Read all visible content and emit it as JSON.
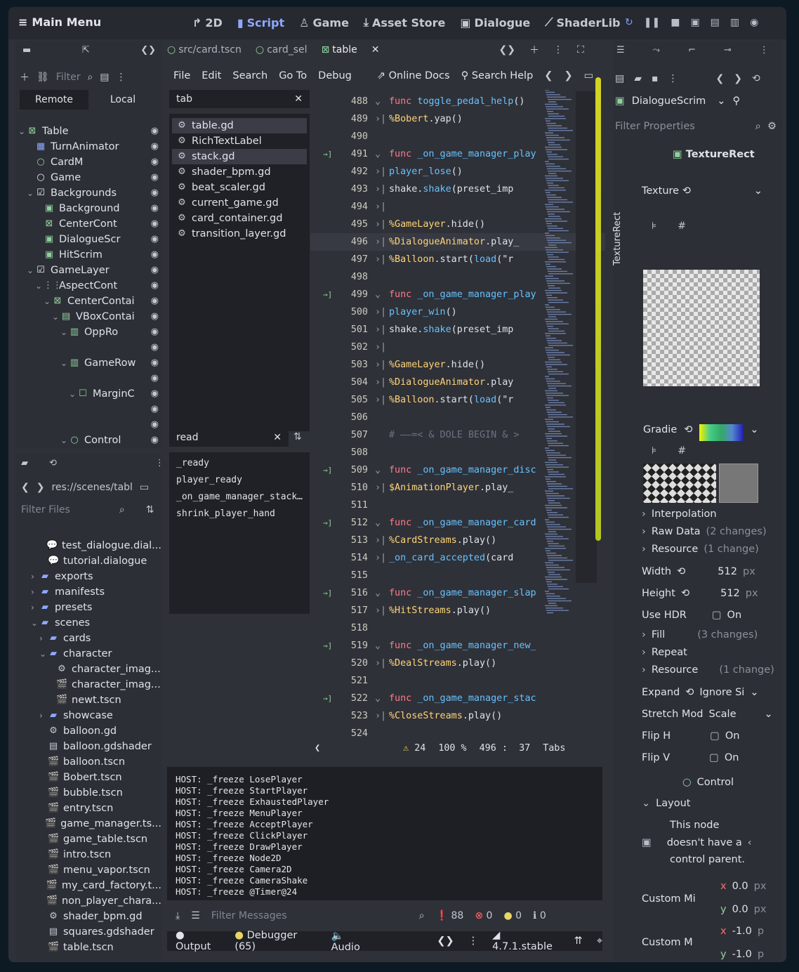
{
  "topbar": {
    "main_menu": "Main Menu",
    "ws_2d": "2D",
    "ws_script": "Script",
    "ws_game": "Game",
    "ws_asset": "Asset Store",
    "ws_dialogue": "Dialogue",
    "ws_shader": "ShaderLib"
  },
  "scene": {
    "remote": "Remote",
    "local": "Local",
    "filter": "Filter",
    "tree": [
      {
        "label": "Table",
        "indent": 0,
        "icon": "⊠",
        "color": "green",
        "arrow": "⌄"
      },
      {
        "label": "TurnAnimator",
        "indent": 1,
        "icon": "▦",
        "color": "blue"
      },
      {
        "label": "CardM",
        "indent": 1,
        "icon": "○",
        "color": "green"
      },
      {
        "label": "Game",
        "indent": 1,
        "icon": "○",
        "color": "white"
      },
      {
        "label": "Backgrounds",
        "indent": 1,
        "icon": "☑",
        "color": "white",
        "arrow": "⌄"
      },
      {
        "label": "Background",
        "indent": 2,
        "icon": "▣",
        "color": "green"
      },
      {
        "label": "CenterCont",
        "indent": 2,
        "icon": "⊠",
        "color": "green"
      },
      {
        "label": "DialogueScr",
        "indent": 2,
        "icon": "▣",
        "color": "green"
      },
      {
        "label": "HitScrim",
        "indent": 2,
        "icon": "▣",
        "color": "green"
      },
      {
        "label": "GameLayer",
        "indent": 1,
        "icon": "☑",
        "color": "white",
        "arrow": "⌄"
      },
      {
        "label": "AspectCont",
        "indent": 2,
        "icon": "⋮⋮",
        "color": "green",
        "arrow": "⌄"
      },
      {
        "label": "CenterContai",
        "indent": 3,
        "icon": "⊠",
        "color": "green",
        "arrow": "⌄"
      },
      {
        "label": "VBoxContai",
        "indent": 4,
        "icon": "▤",
        "color": "green",
        "arrow": "⌄"
      },
      {
        "label": "OppRo",
        "indent": 5,
        "icon": "▥",
        "color": "green",
        "arrow": "⌄"
      },
      {
        "label": "",
        "indent": 6,
        "icon": "",
        "color": "green"
      },
      {
        "label": "GameRow",
        "indent": 5,
        "icon": "▥",
        "color": "green",
        "arrow": "⌄"
      },
      {
        "label": "",
        "indent": 6,
        "icon": "",
        "color": "green"
      },
      {
        "label": "MarginC",
        "indent": 6,
        "icon": "☐",
        "color": "green",
        "arrow": "⌄"
      },
      {
        "label": "",
        "indent": 7,
        "icon": "",
        "color": "green"
      },
      {
        "label": "",
        "indent": 6,
        "icon": "",
        "color": "green"
      },
      {
        "label": "Control",
        "indent": 5,
        "icon": "○",
        "color": "green",
        "arrow": "⌄"
      }
    ]
  },
  "fs": {
    "path": "res://scenes/tabl",
    "filter": "Filter Files",
    "files": [
      {
        "label": "test_dialogue.dial...",
        "indent": 1,
        "icon": "💬"
      },
      {
        "label": "tutorial.dialogue",
        "indent": 1,
        "icon": "💬"
      },
      {
        "label": "exports",
        "indent": 0,
        "icon": "▰",
        "folder": true,
        "arrow": "›"
      },
      {
        "label": "manifests",
        "indent": 0,
        "icon": "▰",
        "folder": true,
        "arrow": "›"
      },
      {
        "label": "presets",
        "indent": 0,
        "icon": "▰",
        "folder": true,
        "arrow": "›"
      },
      {
        "label": "scenes",
        "indent": 0,
        "icon": "▰",
        "folder": true,
        "arrow": "⌄"
      },
      {
        "label": "cards",
        "indent": 1,
        "icon": "▰",
        "folder": true,
        "arrow": "›"
      },
      {
        "label": "character",
        "indent": 1,
        "icon": "▰",
        "folder": true,
        "arrow": "⌄"
      },
      {
        "label": "character_imag...",
        "indent": 2,
        "icon": "⚙"
      },
      {
        "label": "character_imag...",
        "indent": 2,
        "icon": "🎬"
      },
      {
        "label": "newt.tscn",
        "indent": 2,
        "icon": "🎬"
      },
      {
        "label": "showcase",
        "indent": 1,
        "icon": "▰",
        "folder": true,
        "arrow": "›"
      },
      {
        "label": "balloon.gd",
        "indent": 1,
        "icon": "⚙"
      },
      {
        "label": "balloon.gdshader",
        "indent": 1,
        "icon": "▤"
      },
      {
        "label": "balloon.tscn",
        "indent": 1,
        "icon": "🎬"
      },
      {
        "label": "Bobert.tscn",
        "indent": 1,
        "icon": "🎬"
      },
      {
        "label": "bubble.tscn",
        "indent": 1,
        "icon": "🎬"
      },
      {
        "label": "entry.tscn",
        "indent": 1,
        "icon": "🎬"
      },
      {
        "label": "game_manager.ts...",
        "indent": 1,
        "icon": "🎬"
      },
      {
        "label": "game_table.tscn",
        "indent": 1,
        "icon": "🎬"
      },
      {
        "label": "intro.tscn",
        "indent": 1,
        "icon": "🎬"
      },
      {
        "label": "menu_vapor.tscn",
        "indent": 1,
        "icon": "🎬"
      },
      {
        "label": "my_card_factory.t...",
        "indent": 1,
        "icon": "🎬"
      },
      {
        "label": "non_player_chara...",
        "indent": 1,
        "icon": "🎬"
      },
      {
        "label": "shader_bpm.gd",
        "indent": 1,
        "icon": "⚙"
      },
      {
        "label": "squares.gdshader",
        "indent": 1,
        "icon": "▤"
      },
      {
        "label": "table.tscn",
        "indent": 1,
        "icon": "🎬"
      }
    ]
  },
  "tabs": {
    "t1": "src/card.tscn",
    "t2": "card_sel",
    "t3": "table"
  },
  "menu": {
    "file": "File",
    "edit": "Edit",
    "search": "Search",
    "goto": "Go To",
    "debug": "Debug",
    "docs": "Online Docs",
    "help": "Search Help"
  },
  "scripts": {
    "filter": "tab",
    "items": [
      "table.gd",
      "RichTextLabel",
      "stack.gd",
      "shader_bpm.gd",
      "beat_scaler.gd",
      "current_game.gd",
      "card_container.gd",
      "transition_layer.gd"
    ]
  },
  "methods": {
    "filter": "read",
    "items": [
      "_ready",
      "player_ready",
      "_on_game_manager_stack…",
      "shrink_player_hand"
    ]
  },
  "code": [
    {
      "n": "488",
      "fold": "⌄",
      "t": [
        [
          "kw",
          "func "
        ],
        [
          "fn",
          "toggle_pedal_help"
        ],
        [
          "",
          "()"
        ]
      ]
    },
    {
      "n": "489",
      "fold": "›|",
      "t": [
        [
          "str",
          "%Bobert"
        ],
        [
          "",
          ".yap()"
        ]
      ]
    },
    {
      "n": "490",
      "fold": "",
      "t": []
    },
    {
      "n": "491",
      "fold": "⌄",
      "mark": "→]",
      "t": [
        [
          "kw",
          "func "
        ],
        [
          "fn",
          "_on_game_manager_play"
        ]
      ]
    },
    {
      "n": "492",
      "fold": "›|",
      "t": [
        [
          "fn",
          "player_lose"
        ],
        [
          "",
          "()"
        ]
      ]
    },
    {
      "n": "493",
      "fold": "›|",
      "t": [
        [
          "",
          "shake."
        ],
        [
          "fn",
          "shake"
        ],
        [
          "",
          "(preset_imp"
        ]
      ]
    },
    {
      "n": "494",
      "fold": "›|",
      "t": []
    },
    {
      "n": "495",
      "fold": "›|",
      "t": [
        [
          "str",
          "%GameLayer"
        ],
        [
          "",
          ".hide()"
        ]
      ]
    },
    {
      "n": "496",
      "fold": "›|",
      "t": [
        [
          "str",
          "%DialogueAnimator"
        ],
        [
          "",
          ".play_"
        ]
      ],
      "hl": true
    },
    {
      "n": "497",
      "fold": "›|",
      "t": [
        [
          "str",
          "%Balloon"
        ],
        [
          "",
          ".start("
        ],
        [
          "fn",
          "load"
        ],
        [
          "",
          "(\"r"
        ]
      ]
    },
    {
      "n": "498",
      "fold": "",
      "t": []
    },
    {
      "n": "499",
      "fold": "⌄",
      "mark": "→]",
      "t": [
        [
          "kw",
          "func "
        ],
        [
          "fn",
          "_on_game_manager_play"
        ]
      ]
    },
    {
      "n": "500",
      "fold": "›|",
      "t": [
        [
          "fn",
          "player_win"
        ],
        [
          "",
          "()"
        ]
      ]
    },
    {
      "n": "501",
      "fold": "›|",
      "t": [
        [
          "",
          "shake."
        ],
        [
          "fn",
          "shake"
        ],
        [
          "",
          "(preset_imp"
        ]
      ]
    },
    {
      "n": "502",
      "fold": "›|",
      "t": []
    },
    {
      "n": "503",
      "fold": "›|",
      "t": [
        [
          "str",
          "%GameLayer"
        ],
        [
          "",
          ".hide()"
        ]
      ]
    },
    {
      "n": "504",
      "fold": "›|",
      "t": [
        [
          "str",
          "%DialogueAnimator"
        ],
        [
          "",
          ".play"
        ]
      ]
    },
    {
      "n": "505",
      "fold": "›|",
      "t": [
        [
          "str",
          "%Balloon"
        ],
        [
          "",
          ".start("
        ],
        [
          "fn",
          "load"
        ],
        [
          "",
          "(\"r"
        ]
      ]
    },
    {
      "n": "506",
      "fold": "",
      "t": []
    },
    {
      "n": "507",
      "fold": "",
      "t": [
        [
          "cm",
          "# ——=< & DOLE BEGIN & >"
        ]
      ]
    },
    {
      "n": "508",
      "fold": "",
      "t": []
    },
    {
      "n": "509",
      "fold": "⌄",
      "mark": "→]",
      "t": [
        [
          "kw",
          "func "
        ],
        [
          "fn",
          "_on_game_manager_disc"
        ]
      ]
    },
    {
      "n": "510",
      "fold": "›|",
      "t": [
        [
          "str",
          "$AnimationPlayer"
        ],
        [
          "",
          ".play_"
        ]
      ]
    },
    {
      "n": "511",
      "fold": "",
      "t": []
    },
    {
      "n": "512",
      "fold": "⌄",
      "mark": "→]",
      "t": [
        [
          "kw",
          "func "
        ],
        [
          "fn",
          "_on_game_manager_card"
        ]
      ]
    },
    {
      "n": "513",
      "fold": "›|",
      "t": [
        [
          "str",
          "%CardStreams"
        ],
        [
          "",
          ".play()"
        ]
      ]
    },
    {
      "n": "514",
      "fold": "›|",
      "t": [
        [
          "fn",
          "_on_card_accepted"
        ],
        [
          "",
          "(card"
        ]
      ]
    },
    {
      "n": "515",
      "fold": "",
      "t": []
    },
    {
      "n": "516",
      "fold": "⌄",
      "mark": "→]",
      "t": [
        [
          "kw",
          "func "
        ],
        [
          "fn",
          "_on_game_manager_slap"
        ]
      ]
    },
    {
      "n": "517",
      "fold": "›|",
      "t": [
        [
          "str",
          "%HitStreams"
        ],
        [
          "",
          ".play()"
        ]
      ]
    },
    {
      "n": "518",
      "fold": "",
      "t": []
    },
    {
      "n": "519",
      "fold": "⌄",
      "mark": "→]",
      "t": [
        [
          "kw",
          "func "
        ],
        [
          "fn",
          "_on_game_manager_new_"
        ]
      ]
    },
    {
      "n": "520",
      "fold": "›|",
      "t": [
        [
          "str",
          "%DealStreams"
        ],
        [
          "",
          ".play()"
        ]
      ]
    },
    {
      "n": "521",
      "fold": "",
      "t": []
    },
    {
      "n": "522",
      "fold": "⌄",
      "mark": "→]",
      "t": [
        [
          "kw",
          "func "
        ],
        [
          "fn",
          "_on_game_manager_stac"
        ]
      ]
    },
    {
      "n": "523",
      "fold": "›|",
      "t": [
        [
          "str",
          "%CloseStreams"
        ],
        [
          "",
          ".play()"
        ]
      ]
    },
    {
      "n": "524",
      "fold": "",
      "t": []
    }
  ],
  "status": {
    "warn": "24",
    "zoom": "100 %",
    "line": "496",
    "sep": ":",
    "col": "37",
    "indent": "Tabs"
  },
  "output": {
    "lines": [
      "HOST: _freeze LosePlayer",
      "HOST: _freeze StartPlayer",
      "HOST: _freeze ExhaustedPlayer",
      "HOST: _freeze MenuPlayer",
      "HOST: _freeze AcceptPlayer",
      "HOST: _freeze ClickPlayer",
      "HOST: _freeze DrawPlayer",
      "HOST: _freeze Node2D",
      "HOST: _freeze Camera2D",
      "HOST: _freeze CameraShake",
      "HOST: _freeze @Timer@24"
    ],
    "filter": "Filter Messages",
    "msgs": "88",
    "errs": "0",
    "warns": "0",
    "infos": "0"
  },
  "bottom": {
    "output": "Output",
    "debugger": "Debugger (65)",
    "audio": "Audio",
    "version": "4.7.1.stable"
  },
  "inspector": {
    "node": "DialogueScrim",
    "filter": "Filter Properties",
    "section": "TextureRect",
    "vtab": "TextureRect",
    "texture": "Texture",
    "gradie": "Gradie",
    "interp": "Interpolation",
    "raw": "Raw Data",
    "raw_changes": "(2 changes)",
    "resource": "Resource",
    "resource_changes": "(1 change)",
    "width": "Width",
    "width_val": "512",
    "height": "Height",
    "height_val": "512",
    "px": "px",
    "hdr": "Use HDR",
    "on": "On",
    "fill": "Fill",
    "fill_changes": "(3 changes)",
    "repeat": "Repeat",
    "resource2": "Resource",
    "resource2_changes": "(1 change)",
    "expand": "Expand",
    "expand_val": "Ignore Si",
    "stretch": "Stretch Mod",
    "stretch_val": "Scale",
    "fliph": "Flip H",
    "flipv": "Flip V",
    "control": "Control",
    "layout": "Layout",
    "msg1": "This node",
    "msg2": "doesn't have a",
    "msg3": "control parent.",
    "custom_min": "Custom Mi",
    "custom_m2": "Custom M",
    "x": "x",
    "y": "y",
    "v00": "0.0",
    "v01": "0.0",
    "v10": "-1.0",
    "v11": "-1.0",
    "p": "p"
  }
}
